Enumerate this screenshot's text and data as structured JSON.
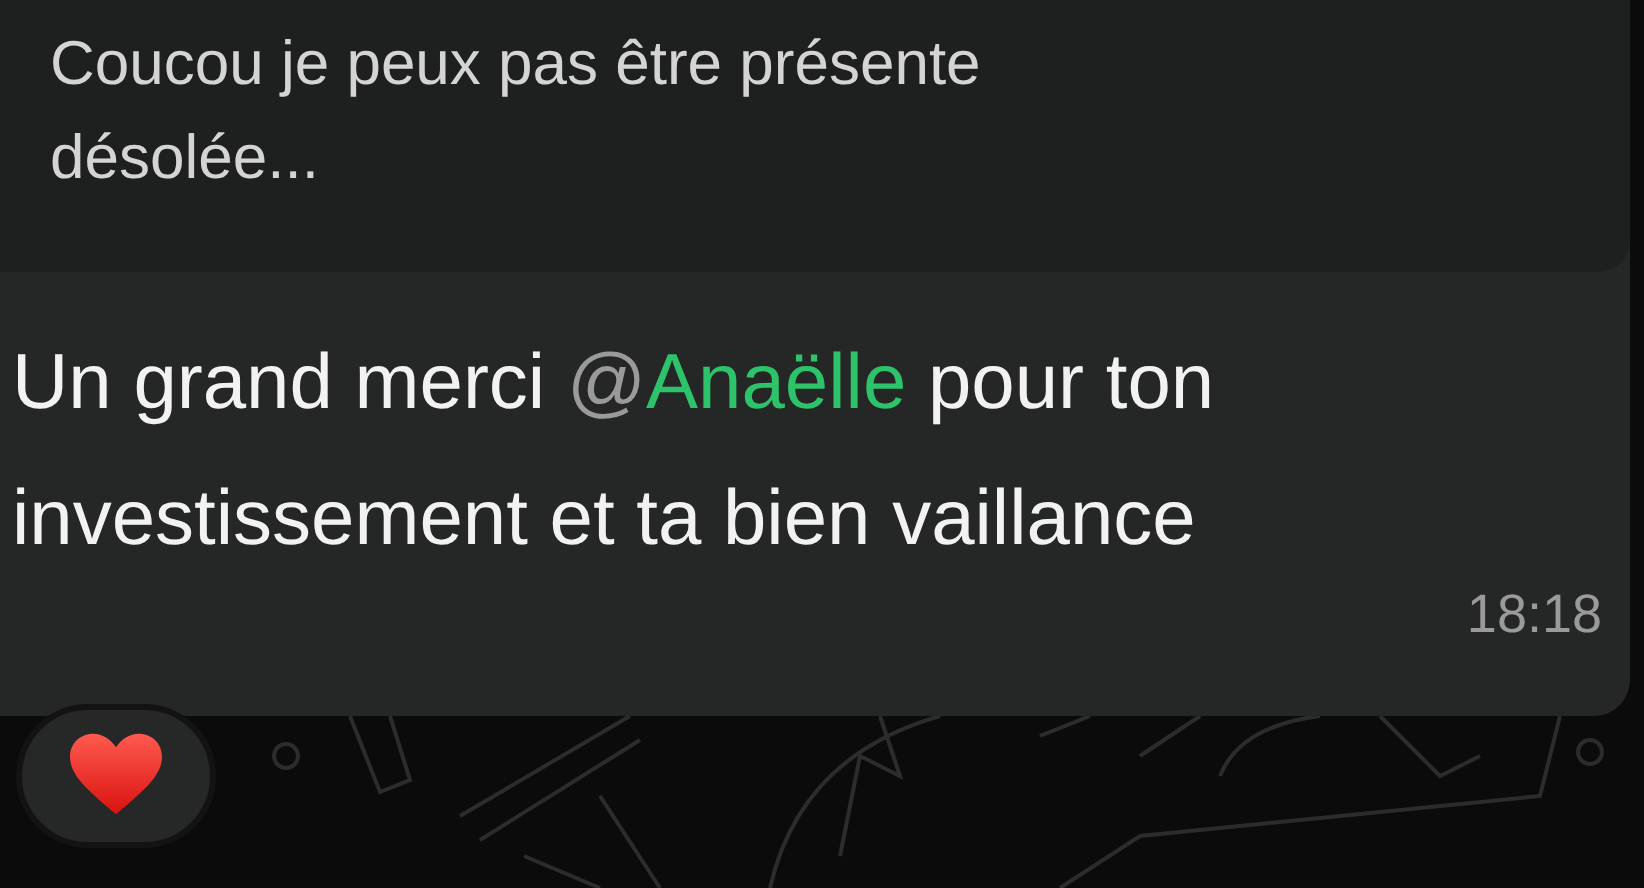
{
  "quoted_message": {
    "text": "Coucou je peux pas être présente désolée..."
  },
  "message": {
    "parts": [
      {
        "kind": "text",
        "text": "Un grand merci "
      },
      {
        "kind": "mention",
        "at": "@",
        "name": "Anaëlle"
      },
      {
        "kind": "text",
        "text": " pour ton investissement et ta bien vaillance"
      }
    ],
    "time": "18:18"
  },
  "reaction": {
    "kind": "heart"
  }
}
